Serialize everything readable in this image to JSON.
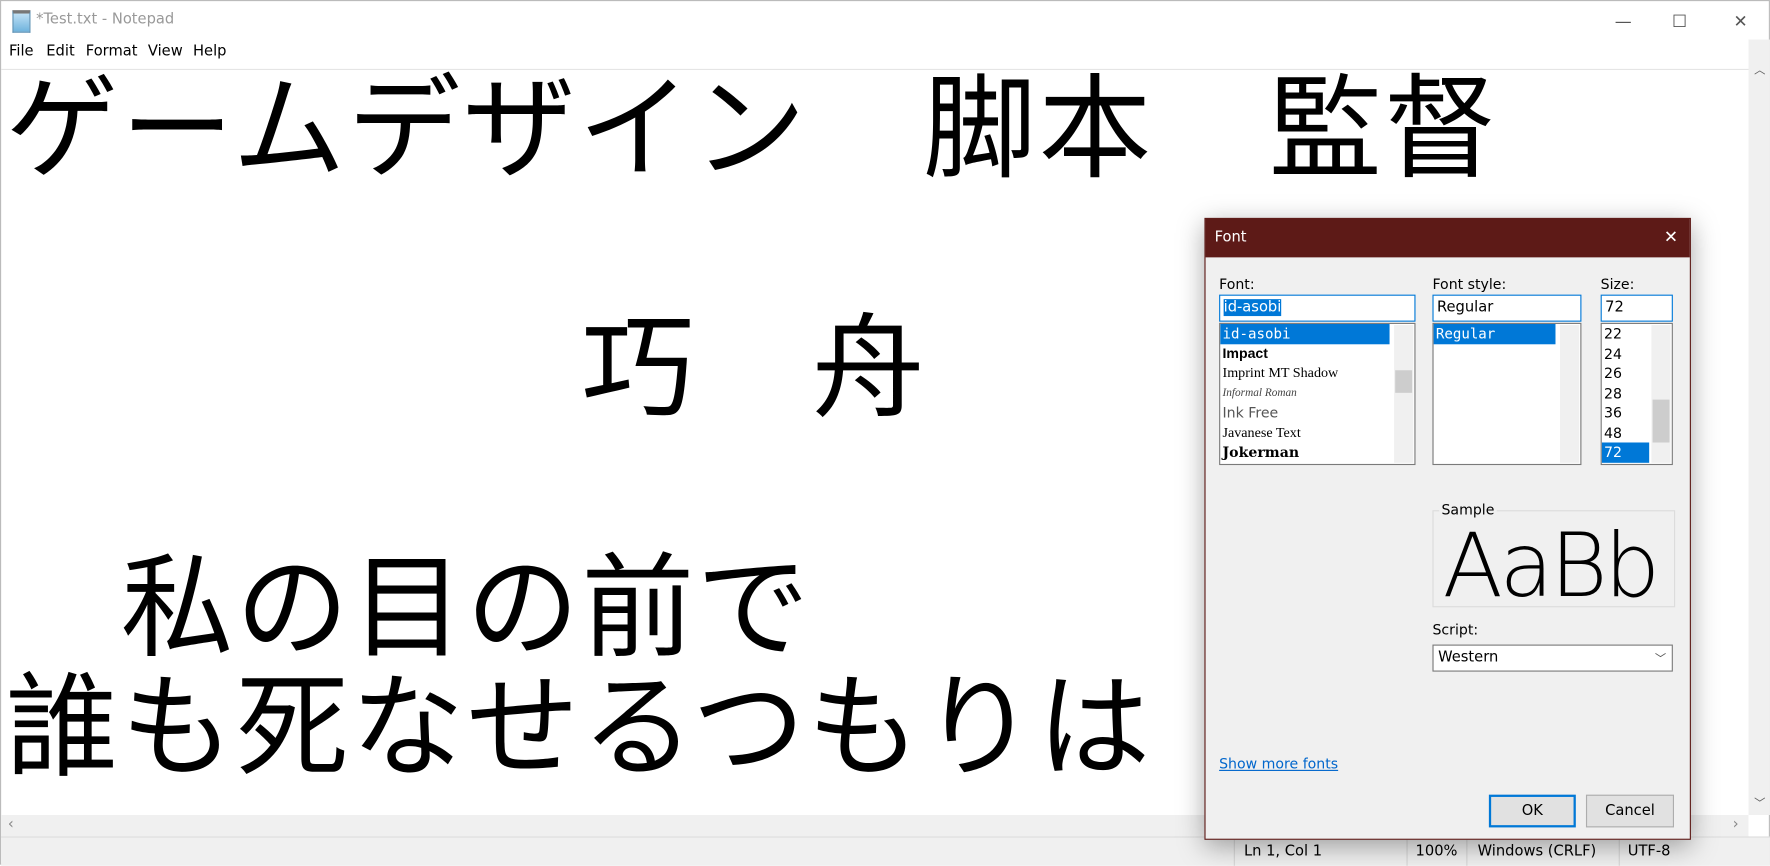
{
  "window": {
    "title": "*Test.txt - Notepad",
    "minimize": "—",
    "maximize": "☐",
    "close": "✕"
  },
  "menu": [
    "File",
    "Edit",
    "Format",
    "View",
    "Help"
  ],
  "editor": {
    "lines": [
      "ゲームデザイン　脚本　監督",
      "",
      "　　　　　巧　舟",
      "",
      "　私の目の前で",
      "誰も死なせるつもりは"
    ]
  },
  "status": {
    "position": "Ln 1, Col 1",
    "zoom": "100%",
    "line_ending": "Windows (CRLF)",
    "encoding": "UTF-8"
  },
  "dialog": {
    "title": "Font",
    "close": "✕",
    "font_label": "Font:",
    "font_value": "id-asobi",
    "fonts": [
      "id-asobi",
      "Impact",
      "Imprint MT Shadow",
      "Informal Roman",
      "Ink Free",
      "Javanese Text",
      "Jokerman"
    ],
    "style_label": "Font style:",
    "style_value": "Regular",
    "styles": [
      "Regular"
    ],
    "size_label": "Size:",
    "size_value": "72",
    "sizes": [
      "22",
      "24",
      "26",
      "28",
      "36",
      "48",
      "72"
    ],
    "sample_label": "Sample",
    "sample_text": "AaBb",
    "script_label": "Script:",
    "script_value": "Western",
    "show_more": "Show more fonts",
    "ok": "OK",
    "cancel": "Cancel"
  },
  "colors": {
    "accent": "#0078d7",
    "dialog_title": "#5d1a17",
    "link": "#0066cc"
  }
}
